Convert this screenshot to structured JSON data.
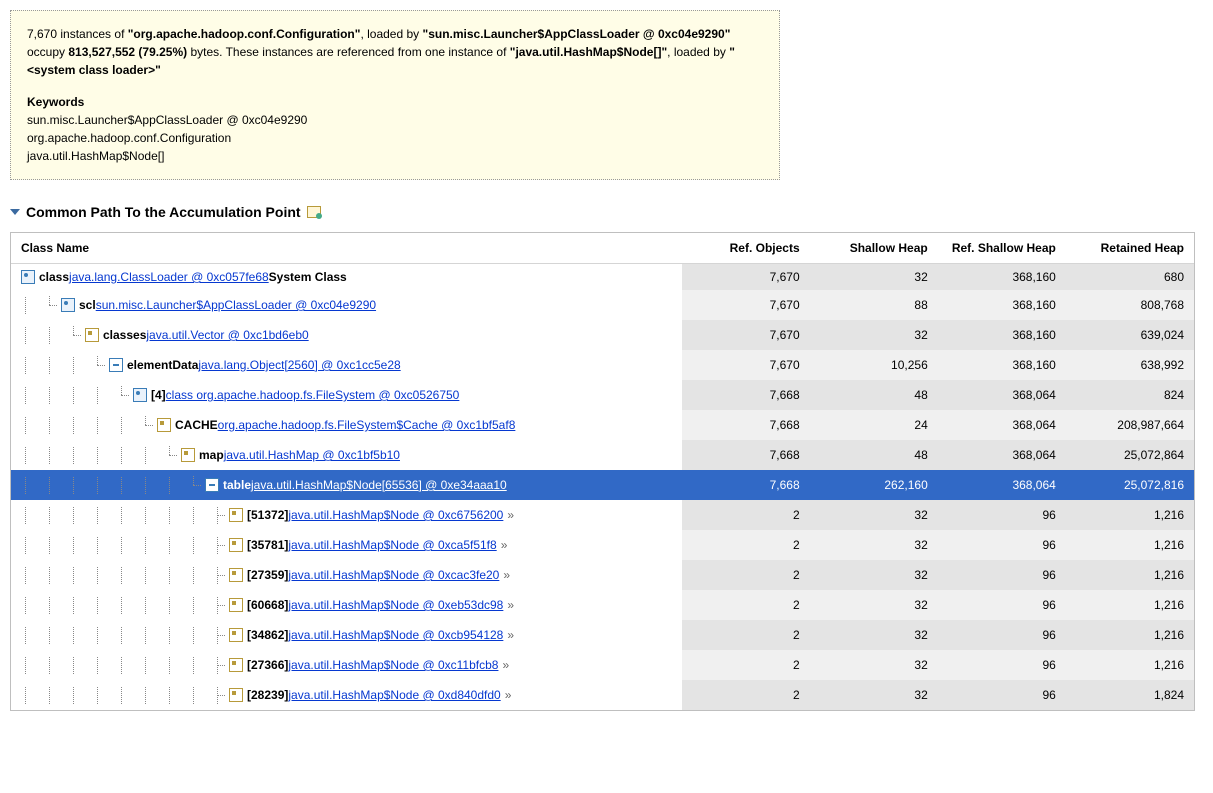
{
  "info": {
    "line1_a": "7,670 instances of ",
    "line1_b": "\"org.apache.hadoop.conf.Configuration\"",
    "line1_c": ", loaded by ",
    "line2_a": "\"sun.misc.Launcher$AppClassLoader @ 0xc04e9290\"",
    "line2_b": " occupy ",
    "line2_c": "813,527,552 (79.25%)",
    "line2_d": " bytes. These instances are referenced from one instance of ",
    "line3_a": "\"java.util.HashMap$Node[]\"",
    "line3_b": ", loaded by ",
    "line3_c": "\"<system class loader>\"",
    "kw_label": "Keywords",
    "kw1": "sun.misc.Launcher$AppClassLoader @ 0xc04e9290",
    "kw2": "org.apache.hadoop.conf.Configuration",
    "kw3": "java.util.HashMap$Node[]"
  },
  "section": {
    "title": "Common Path To the Accumulation Point"
  },
  "columns": {
    "name": "Class Name",
    "refobj": "Ref. Objects",
    "shallow": "Shallow Heap",
    "refshallow": "Ref. Shallow Heap",
    "retained": "Retained Heap"
  },
  "rows": [
    {
      "depth": 0,
      "icon": "class",
      "prefix_bold": "class",
      "link": "java.lang.ClassLoader @ 0xc057fe68",
      "suffix_bold": "System Class",
      "refobj": "7,670",
      "shallow": "32",
      "refshallow": "368,160",
      "retained": "680",
      "alt": true
    },
    {
      "depth": 1,
      "icon": "class",
      "prefix_bold": "scl",
      "link": "sun.misc.Launcher$AppClassLoader @ 0xc04e9290",
      "refobj": "7,670",
      "shallow": "88",
      "refshallow": "368,160",
      "retained": "808,768",
      "alt": false
    },
    {
      "depth": 2,
      "icon": "obj",
      "prefix_bold": "classes",
      "link": "java.util.Vector @ 0xc1bd6eb0",
      "refobj": "7,670",
      "shallow": "32",
      "refshallow": "368,160",
      "retained": "639,024",
      "alt": true
    },
    {
      "depth": 3,
      "icon": "array",
      "prefix_bold": "elementData",
      "link": "java.lang.Object[2560] @ 0xc1cc5e28",
      "refobj": "7,670",
      "shallow": "10,256",
      "refshallow": "368,160",
      "retained": "638,992",
      "alt": false
    },
    {
      "depth": 4,
      "icon": "class",
      "prefix_bold": "[4]",
      "link": "class org.apache.hadoop.fs.FileSystem @ 0xc0526750",
      "refobj": "7,668",
      "shallow": "48",
      "refshallow": "368,064",
      "retained": "824",
      "alt": true
    },
    {
      "depth": 5,
      "icon": "obj",
      "prefix_bold": "CACHE",
      "link": "org.apache.hadoop.fs.FileSystem$Cache @ 0xc1bf5af8",
      "refobj": "7,668",
      "shallow": "24",
      "refshallow": "368,064",
      "retained": "208,987,664",
      "alt": false
    },
    {
      "depth": 6,
      "icon": "obj",
      "prefix_bold": "map",
      "link": "java.util.HashMap @ 0xc1bf5b10",
      "refobj": "7,668",
      "shallow": "48",
      "refshallow": "368,064",
      "retained": "25,072,864",
      "alt": true
    },
    {
      "depth": 7,
      "icon": "array",
      "prefix_bold": "table",
      "link": "java.util.HashMap$Node[65536] @ 0xe34aaa10",
      "refobj": "7,668",
      "shallow": "262,160",
      "refshallow": "368,064",
      "retained": "25,072,816",
      "selected": true
    },
    {
      "depth": 8,
      "icon": "obj",
      "prefix_bold": "[51372]",
      "link": "java.util.HashMap$Node @ 0xc6756200",
      "chevron": true,
      "refobj": "2",
      "shallow": "32",
      "refshallow": "96",
      "retained": "1,216",
      "alt": true,
      "cont": true
    },
    {
      "depth": 8,
      "icon": "obj",
      "prefix_bold": "[35781]",
      "link": "java.util.HashMap$Node @ 0xca5f51f8",
      "chevron": true,
      "refobj": "2",
      "shallow": "32",
      "refshallow": "96",
      "retained": "1,216",
      "alt": false,
      "cont": true
    },
    {
      "depth": 8,
      "icon": "obj",
      "prefix_bold": "[27359]",
      "link": "java.util.HashMap$Node @ 0xcac3fe20",
      "chevron": true,
      "refobj": "2",
      "shallow": "32",
      "refshallow": "96",
      "retained": "1,216",
      "alt": true,
      "cont": true
    },
    {
      "depth": 8,
      "icon": "obj",
      "prefix_bold": "[60668]",
      "link": "java.util.HashMap$Node @ 0xeb53dc98",
      "chevron": true,
      "refobj": "2",
      "shallow": "32",
      "refshallow": "96",
      "retained": "1,216",
      "alt": false,
      "cont": true
    },
    {
      "depth": 8,
      "icon": "obj",
      "prefix_bold": "[34862]",
      "link": "java.util.HashMap$Node @ 0xcb954128",
      "chevron": true,
      "refobj": "2",
      "shallow": "32",
      "refshallow": "96",
      "retained": "1,216",
      "alt": true,
      "cont": true
    },
    {
      "depth": 8,
      "icon": "obj",
      "prefix_bold": "[27366]",
      "link": "java.util.HashMap$Node @ 0xc11bfcb8",
      "chevron": true,
      "refobj": "2",
      "shallow": "32",
      "refshallow": "96",
      "retained": "1,216",
      "alt": false,
      "cont": true
    },
    {
      "depth": 8,
      "icon": "obj",
      "prefix_bold": "[28239]",
      "link": "java.util.HashMap$Node @ 0xd840dfd0",
      "chevron": true,
      "refobj": "2",
      "shallow": "32",
      "refshallow": "96",
      "retained": "1,824",
      "alt": true,
      "cont": true
    }
  ]
}
